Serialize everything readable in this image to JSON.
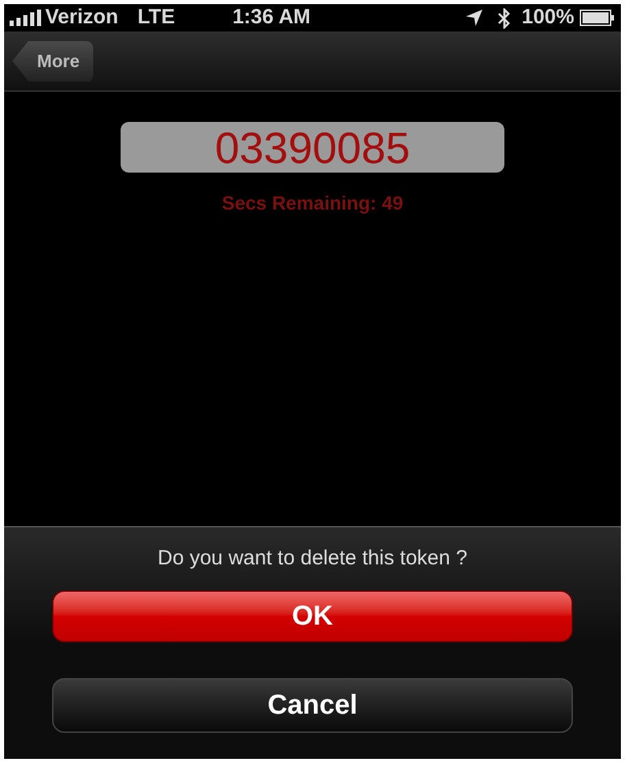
{
  "status_bar": {
    "carrier": "Verizon",
    "network": "LTE",
    "time": "1:36 AM",
    "battery": "100%"
  },
  "nav_bar": {
    "back_button": "More"
  },
  "token": {
    "code": "03390085",
    "countdown": "Secs Remaining: 49"
  },
  "action_sheet": {
    "message": "Do you want to delete this token ?",
    "buttons": [
      {
        "label": "OK",
        "kind": "destructive"
      },
      {
        "label": "Cancel",
        "kind": "cancel"
      }
    ]
  }
}
